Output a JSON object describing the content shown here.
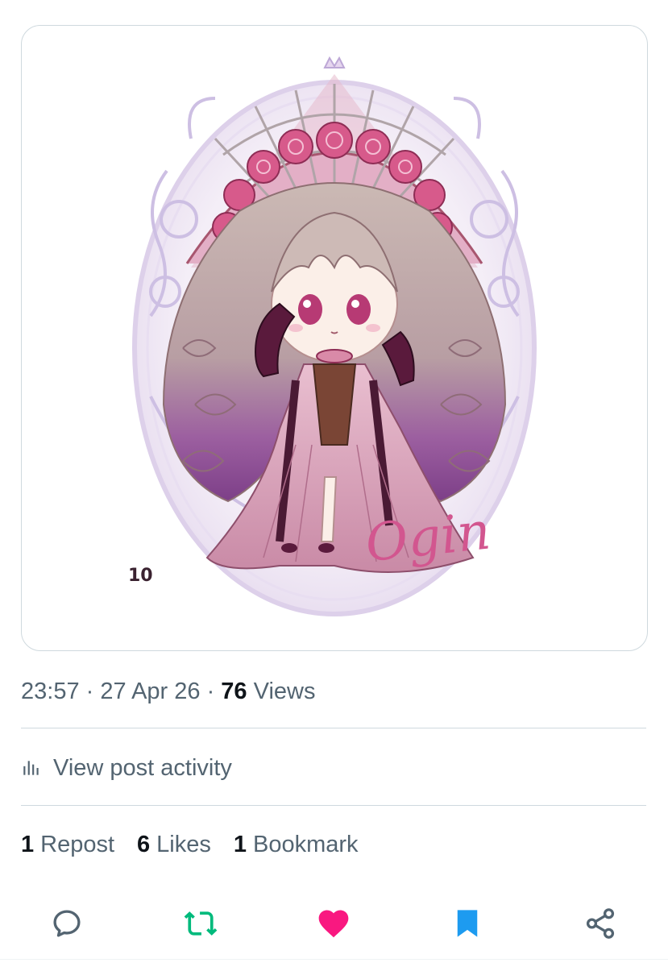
{
  "post": {
    "media": {
      "number_mark": "10",
      "signature": "Ogin"
    },
    "meta": {
      "time": "23:57",
      "separator_1": " · ",
      "date": "27 Apr 26",
      "separator_2": " · ",
      "views_count": "76",
      "views_label": "Views"
    },
    "activity": {
      "icon": "analytics-icon",
      "label": "View post activity"
    },
    "stats": {
      "reposts": {
        "count": "1",
        "label": "Repost"
      },
      "likes": {
        "count": "6",
        "label": "Likes"
      },
      "bookmarks": {
        "count": "1",
        "label": "Bookmark"
      }
    },
    "actions": {
      "reply_icon": "reply-icon",
      "repost_icon": "repost-icon",
      "like_icon": "heart-icon",
      "bookmark_icon": "bookmark-icon",
      "share_icon": "share-icon"
    }
  },
  "colors": {
    "text_secondary": "#536471",
    "text_primary": "#0f1419",
    "border": "#cfd9de",
    "repost_active": "#00ba7c",
    "like_active": "#f91880",
    "bookmark_active": "#1d9bf0"
  }
}
